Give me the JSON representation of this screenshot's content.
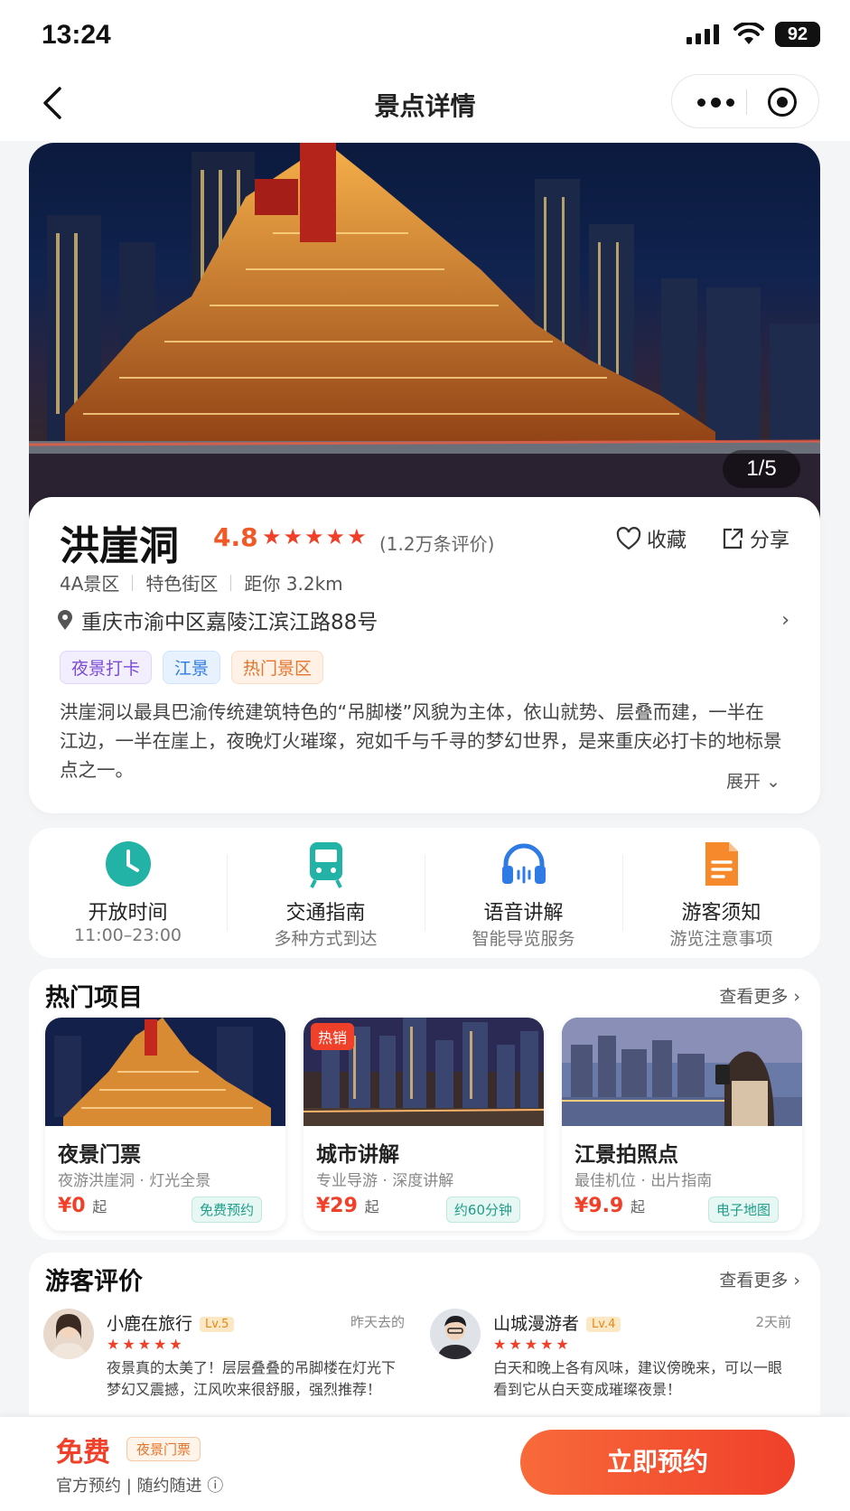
{
  "status": {
    "time": "13:24",
    "battery": "92"
  },
  "nav": {
    "title": "景点详情"
  },
  "hero": {
    "counter": "1/5"
  },
  "place": {
    "name": "洪崖洞",
    "rating": "4.8",
    "stars": "★★★★★",
    "review_count": "(1.2万条评价)",
    "favorite_label": "收藏",
    "share_label": "分享",
    "meta": [
      "4A景区",
      "特色街区",
      "距你 3.2km"
    ],
    "address": "重庆市渝中区嘉陵江滨江路88号",
    "tags": [
      "夜景打卡",
      "江景",
      "热门景区"
    ],
    "description": "洪崖洞以最具巴渝传统建筑特色的“吊脚楼”风貌为主体，依山就势、层叠而建，一半在江边，一半在崖上，夜晚灯火璀璨，宛如千与千寻的梦幻世界，是来重庆必打卡的地标景点之一。",
    "expand_label": "展开"
  },
  "quick": [
    {
      "title": "开放时间",
      "sub": "11:00–23:00",
      "icon": "clock-icon",
      "color": "#22b3a6"
    },
    {
      "title": "交通指南",
      "sub": "多种方式到达",
      "icon": "train-icon",
      "color": "#22b3a6"
    },
    {
      "title": "语音讲解",
      "sub": "智能导览服务",
      "icon": "headphones-icon",
      "color": "#2e7be6"
    },
    {
      "title": "游客须知",
      "sub": "游览注意事项",
      "icon": "document-icon",
      "color": "#f5892b"
    }
  ],
  "hot": {
    "title": "热门项目",
    "more": "查看更多",
    "items": [
      {
        "title": "夜景门票",
        "sub": "夜游洪崖洞 · 灯光全景",
        "price": "¥0",
        "unit": "起",
        "badge": "免费预约"
      },
      {
        "title": "城市讲解",
        "sub": "专业导游 · 深度讲解",
        "price": "¥29",
        "unit": "起",
        "badge": "约60分钟",
        "hot_badge": "热销"
      },
      {
        "title": "江景拍照点",
        "sub": "最佳机位 · 出片指南",
        "price": "¥9.9",
        "unit": "起",
        "badge": "电子地图"
      }
    ]
  },
  "reviews": {
    "title": "游客评价",
    "more": "查看更多",
    "items": [
      {
        "name": "小鹿在旅行",
        "level": "Lv.5",
        "time": "昨天去的",
        "stars": "★★★★★",
        "text": "夜景真的太美了！层层叠叠的吊脚楼在灯光下梦幻又震撼，江风吹来很舒服，强烈推荐！"
      },
      {
        "name": "山城漫游者",
        "level": "Lv.4",
        "time": "2天前",
        "stars": "★★★★★",
        "text": "白天和晚上各有风味，建议傍晚来，可以一眼看到它从白天变成璀璨夜景！"
      }
    ]
  },
  "footer": {
    "price": "免费",
    "ticket_tag": "夜景门票",
    "sub": "官方预约 | 随约随进 ⓘ",
    "book_label": "立即预约"
  }
}
